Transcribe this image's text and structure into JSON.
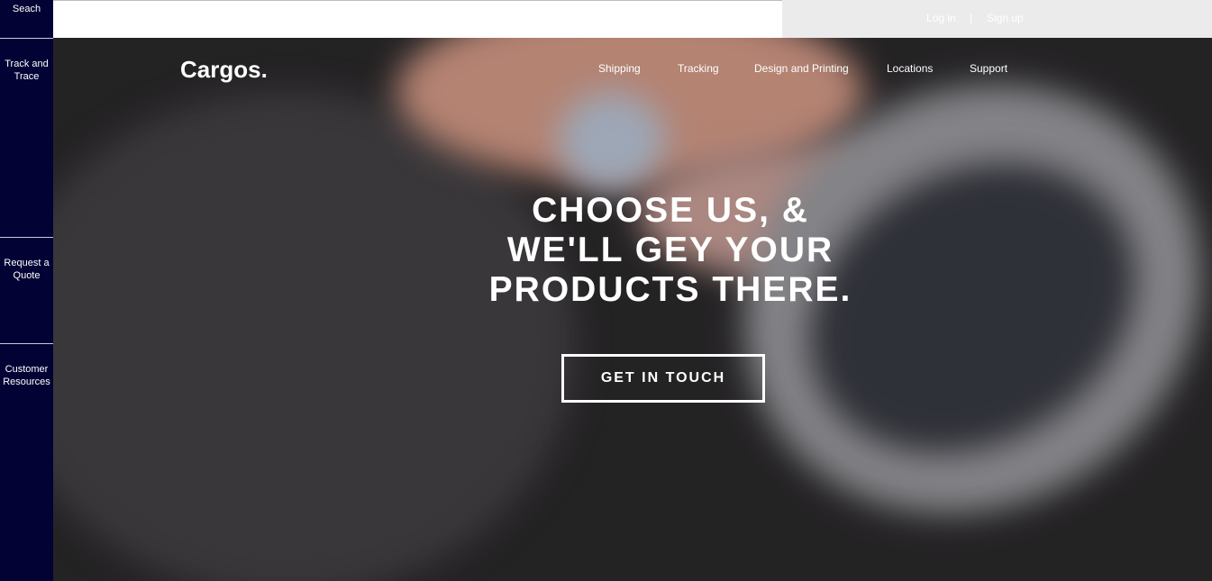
{
  "sidebar": {
    "items": [
      {
        "label": "Seach"
      },
      {
        "label": "Track and Trace"
      },
      {
        "label": "Request a Quote"
      },
      {
        "label": "Customer Resources"
      }
    ],
    "bg_color": "#020235"
  },
  "topbar": {
    "login_label": "Log in",
    "separator": "|",
    "signup_label": "Sign up"
  },
  "header": {
    "logo": "Cargos.",
    "nav": [
      {
        "label": "Shipping"
      },
      {
        "label": "Tracking"
      },
      {
        "label": "Design and Printing"
      },
      {
        "label": "Locations"
      },
      {
        "label": "Support"
      }
    ]
  },
  "hero": {
    "headline": [
      "CHOOSE US, &",
      "WE'LL GEY YOUR",
      "PRODUCTS THERE."
    ],
    "cta_label": "GET IN TOUCH"
  }
}
